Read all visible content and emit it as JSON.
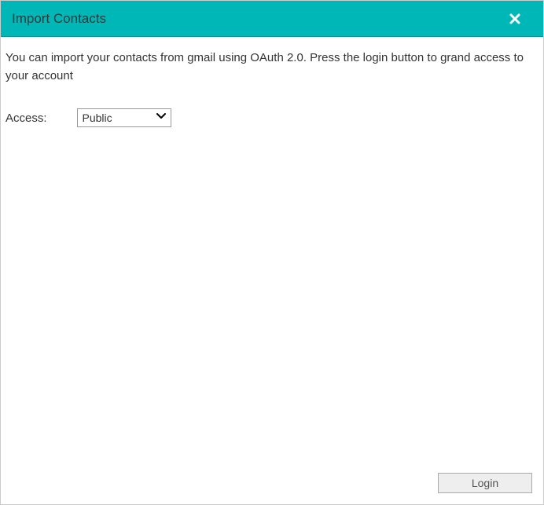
{
  "header": {
    "title": "Import Contacts"
  },
  "body": {
    "description": "You can import your contacts from gmail using OAuth 2.0. Press the login button to grand access to your account",
    "access_label": "Access:",
    "access_value": "Public"
  },
  "footer": {
    "login_label": "Login"
  },
  "icons": {
    "close": "close-icon",
    "chevron": "chevron-down-icon"
  },
  "colors": {
    "accent": "#00b7b7",
    "text": "#333333"
  }
}
